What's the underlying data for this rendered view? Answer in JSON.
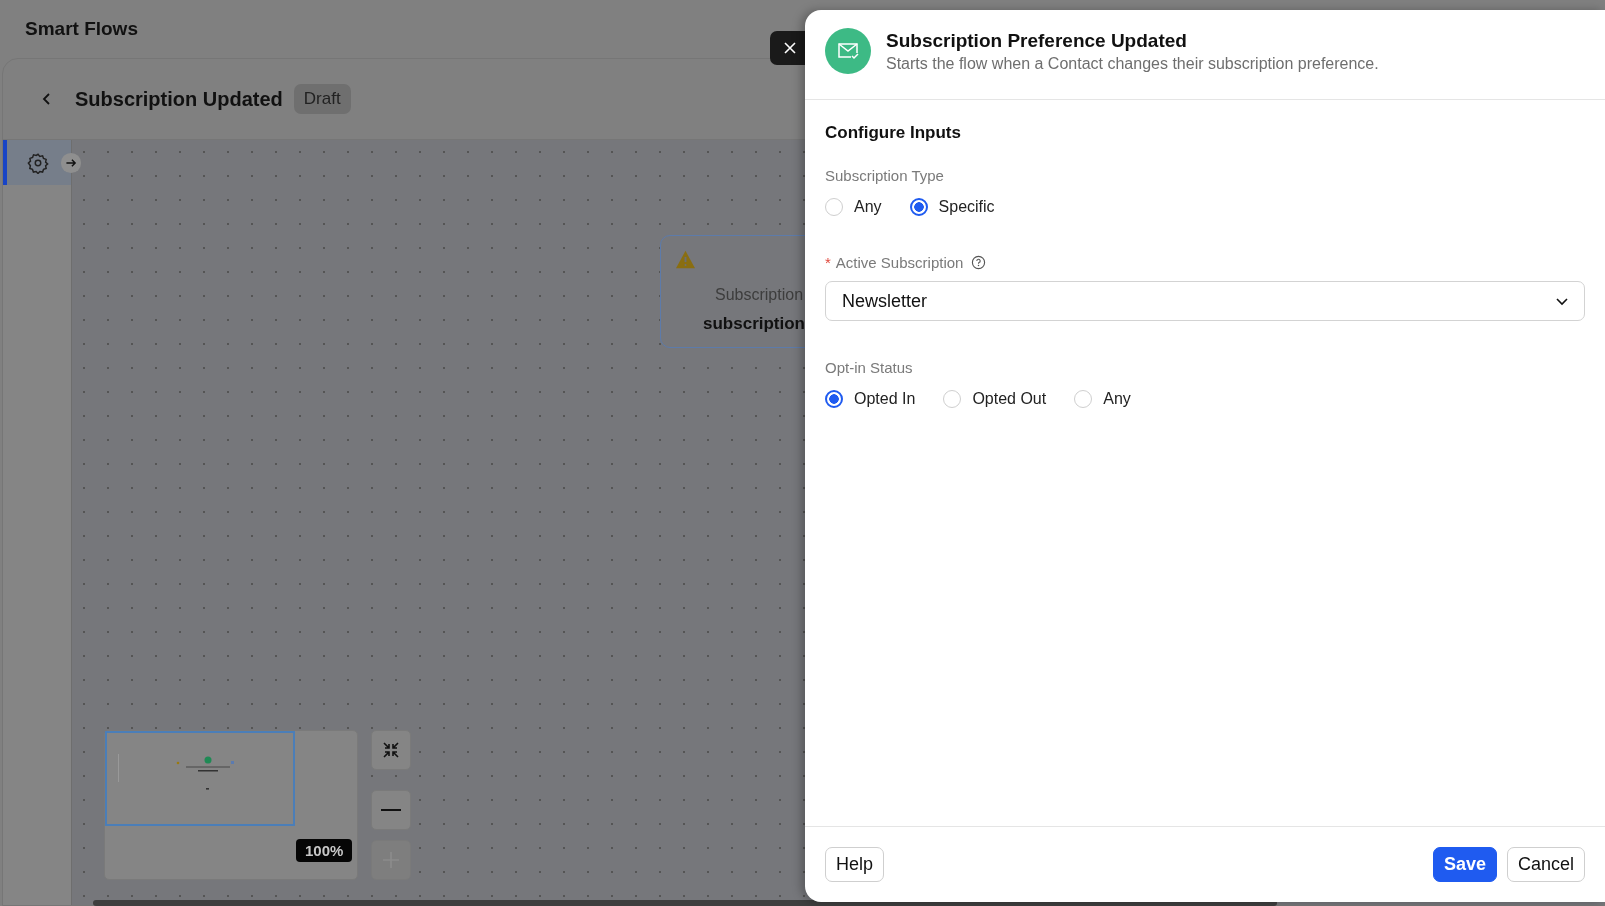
{
  "app": {
    "title": "Smart Flows"
  },
  "flow": {
    "title": "Subscription Updated",
    "status": "Draft"
  },
  "canvas": {
    "node": {
      "label": "Subscription",
      "name": "subscription",
      "warning": true
    },
    "zoom": "100%",
    "zoom_in_disabled": true
  },
  "panel": {
    "title": "Subscription Preference Updated",
    "description": "Starts the flow when a Contact changes their subscription preference.",
    "section": "Configure Inputs",
    "fields": [
      {
        "kind": "radio",
        "label": "Subscription Type",
        "options": [
          {
            "label": "Any",
            "selected": false
          },
          {
            "label": "Specific",
            "selected": true
          }
        ]
      },
      {
        "kind": "select",
        "label": "Active Subscription",
        "required_mark": "*",
        "value": "Newsletter"
      },
      {
        "kind": "radio",
        "label": "Opt-in Status",
        "options": [
          {
            "label": "Opted In",
            "selected": true
          },
          {
            "label": "Opted Out",
            "selected": false
          },
          {
            "label": "Any",
            "selected": false
          }
        ]
      }
    ],
    "buttons": [
      {
        "label": "Help",
        "kind": "default"
      },
      {
        "label": "Save",
        "kind": "primary"
      },
      {
        "label": "Cancel",
        "kind": "default"
      }
    ]
  }
}
